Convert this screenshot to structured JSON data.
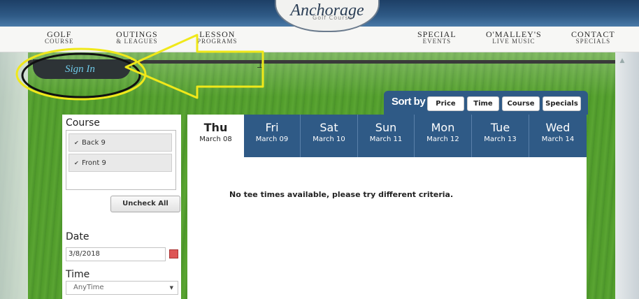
{
  "nav": {
    "items": [
      {
        "line1": "GOLF",
        "line2": "COURSE"
      },
      {
        "line1": "OUTINGS",
        "line2": "& LEAGUES"
      },
      {
        "line1": "LESSON",
        "line2": "PROGRAMS"
      },
      {
        "line1": "SPECIAL",
        "line2": "EVENTS"
      },
      {
        "line1": "O'MALLEY'S",
        "line2": "LIVE MUSIC"
      },
      {
        "line1": "CONTACT",
        "line2": "SPECIALS"
      }
    ],
    "logo_name": "Anchorage",
    "logo_sub": "Golf Course"
  },
  "signin_label": "Sign In",
  "sort": {
    "label": "Sort by",
    "buttons": [
      "Price",
      "Time",
      "Course",
      "Specials"
    ]
  },
  "sidebar": {
    "course_title": "Course",
    "course_options": [
      {
        "label": "Back 9",
        "checked": true
      },
      {
        "label": "Front 9",
        "checked": true
      }
    ],
    "uncheck_label": "Uncheck All",
    "date_title": "Date",
    "date_value": "3/8/2018",
    "time_title": "Time",
    "time_value": "AnyTime"
  },
  "days": [
    {
      "name": "Thu",
      "date": "March 08",
      "active": true
    },
    {
      "name": "Fri",
      "date": "March 09"
    },
    {
      "name": "Sat",
      "date": "March 10"
    },
    {
      "name": "Sun",
      "date": "March 11"
    },
    {
      "name": "Mon",
      "date": "March 12"
    },
    {
      "name": "Tue",
      "date": "March 13"
    },
    {
      "name": "Wed",
      "date": "March 14"
    }
  ],
  "no_results": "No tee times available, please try different criteria.",
  "colors": {
    "brand_blue": "#2f5a86",
    "annotation_yellow": "#f0e81a",
    "signin_text": "#6fc8e6"
  }
}
